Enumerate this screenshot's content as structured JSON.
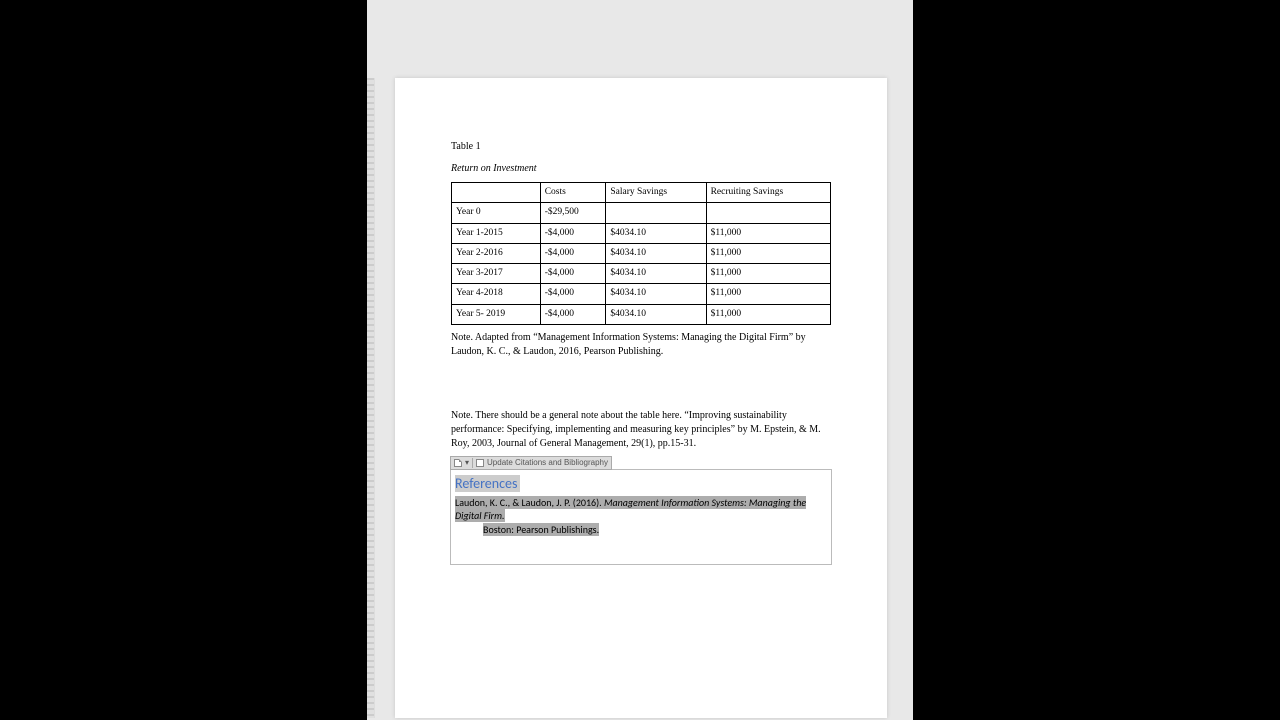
{
  "table": {
    "label": "Table 1",
    "title": "Return on Investment",
    "headers": [
      "",
      "Costs",
      "Salary Savings",
      "Recruiting Savings"
    ],
    "rows": [
      {
        "c0": "Year 0",
        "c1": "-$29,500",
        "c2": "",
        "c3": ""
      },
      {
        "c0": "Year 1-2015",
        "c1": "-$4,000",
        "c2": "$4034.10",
        "c3": "$11,000"
      },
      {
        "c0": "Year 2-2016",
        "c1": "-$4,000",
        "c2": "$4034.10",
        "c3": "$11,000"
      },
      {
        "c0": "Year 3-2017",
        "c1": "-$4,000",
        "c2": "$4034.10",
        "c3": "$11,000"
      },
      {
        "c0": "Year 4-2018",
        "c1": "-$4,000",
        "c2": "$4034.10",
        "c3": "$11,000"
      },
      {
        "c0": "Year 5- 2019",
        "c1": "-$4,000",
        "c2": "$4034.10",
        "c3": "$11,000"
      }
    ]
  },
  "note1": "Note. Adapted from “Management Information Systems: Managing the Digital Firm” by Laudon, K. C., & Laudon, 2016, Pearson Publishing.",
  "note2": "Note. There should be a general note about the table here. “Improving sustainability performance: Specifying, implementing and measuring key principles” by M. Epstein, & M. Roy, 2003, Journal of General Management, 29(1), pp.15-31.",
  "field": {
    "toolbar_drop": "▾",
    "toolbar_label": "Update Citations and Bibliography",
    "heading": "References",
    "entry_plain": "Laudon, K. C., & Laudon, J. P. (2016). ",
    "entry_italic": "Management Information Systems: Managing the Digital Firm.",
    "entry_tail": "Boston: Pearson Publishings."
  }
}
